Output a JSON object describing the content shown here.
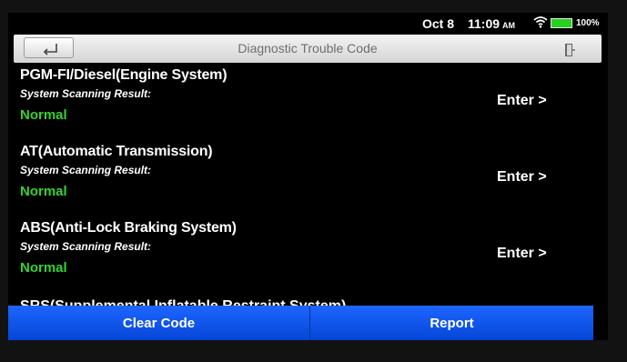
{
  "status_bar": {
    "date": "Oct 8",
    "time": "11:09",
    "ampm": "AM",
    "battery": "100%",
    "battery_color": "#25d21f"
  },
  "header": {
    "title": "Diagnostic Trouble Code",
    "back_icon": "back-arrow-icon",
    "exit_icon": "exit-door-icon"
  },
  "systems": [
    {
      "name": "PGM-FI/Diesel(Engine System)",
      "scan_label": "System Scanning Result:",
      "status": "Normal",
      "enter": "Enter >"
    },
    {
      "name": "AT(Automatic Transmission)",
      "scan_label": "System Scanning Result:",
      "status": "Normal",
      "enter": "Enter >"
    },
    {
      "name": "ABS(Anti-Lock Braking System)",
      "scan_label": "System Scanning Result:",
      "status": "Normal",
      "enter": "Enter >"
    }
  ],
  "partial_item": "SRS(Supplemental Inflatable Restraint System)",
  "footer": {
    "clear_code": "Clear Code",
    "report": "Report",
    "accent_color": "#1358f0"
  },
  "colors": {
    "status_ok": "#35d22e",
    "background": "#000000"
  }
}
